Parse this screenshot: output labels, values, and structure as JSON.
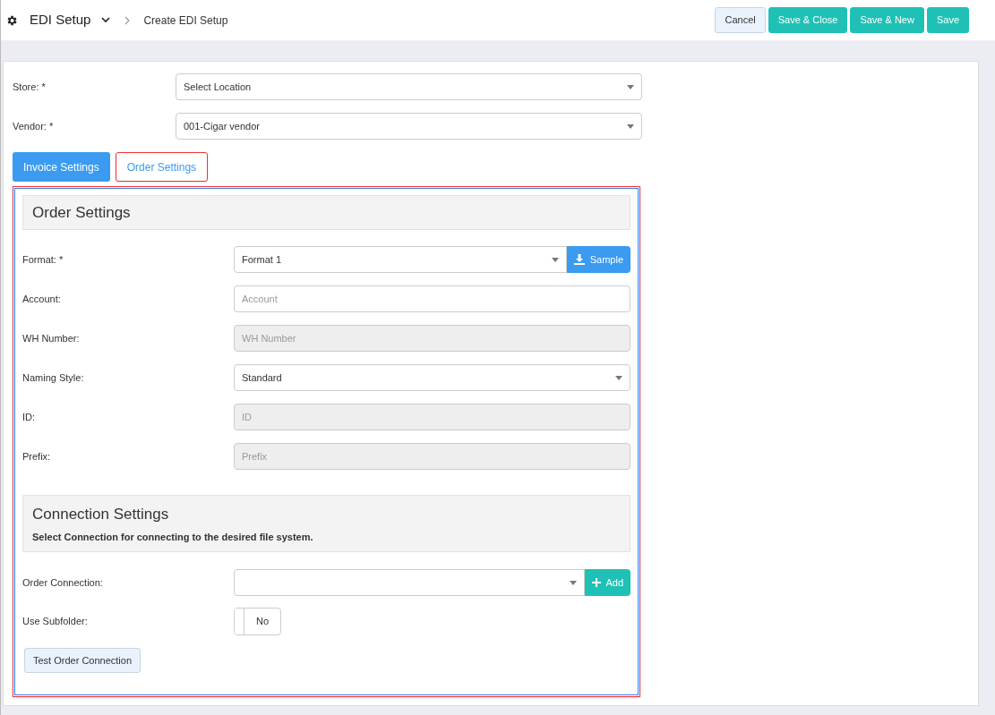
{
  "header": {
    "title": "EDI Setup",
    "breadcrumb": "Create EDI Setup",
    "buttons": [
      {
        "label": "Cancel",
        "kind": "secondary"
      },
      {
        "label": "Save & Close",
        "kind": "primary"
      },
      {
        "label": "Save & New",
        "kind": "primary"
      },
      {
        "label": "Save",
        "kind": "primary"
      }
    ]
  },
  "top_fields": [
    {
      "label": "Store: *",
      "value": "Select Location"
    },
    {
      "label": "Vendor: *",
      "value": "001-Cigar vendor"
    }
  ],
  "tabs": [
    {
      "label": "Invoice Settings",
      "selected": false
    },
    {
      "label": "Order Settings",
      "selected": true
    }
  ],
  "order_settings": {
    "title": "Order Settings",
    "fields": [
      {
        "label": "Format: *",
        "kind": "select",
        "value": "Format 1",
        "button": "Sample"
      },
      {
        "label": "Account:",
        "kind": "input",
        "placeholder": "Account"
      },
      {
        "label": "WH Number:",
        "kind": "disabled",
        "placeholder": "WH Number"
      },
      {
        "label": "Naming Style:",
        "kind": "select",
        "value": "Standard"
      },
      {
        "label": "ID:",
        "kind": "disabled",
        "placeholder": "ID"
      },
      {
        "label": "Prefix:",
        "kind": "disabled",
        "placeholder": "Prefix"
      }
    ]
  },
  "connection_settings": {
    "title": "Connection Settings",
    "subtitle": "Select Connection for connecting to the desired file system.",
    "order_connection": {
      "label": "Order Connection:",
      "button": "Add"
    },
    "use_subfolder": {
      "label": "Use Subfolder:",
      "on": false,
      "value": "No"
    },
    "test_button": "Test Order Connection"
  }
}
